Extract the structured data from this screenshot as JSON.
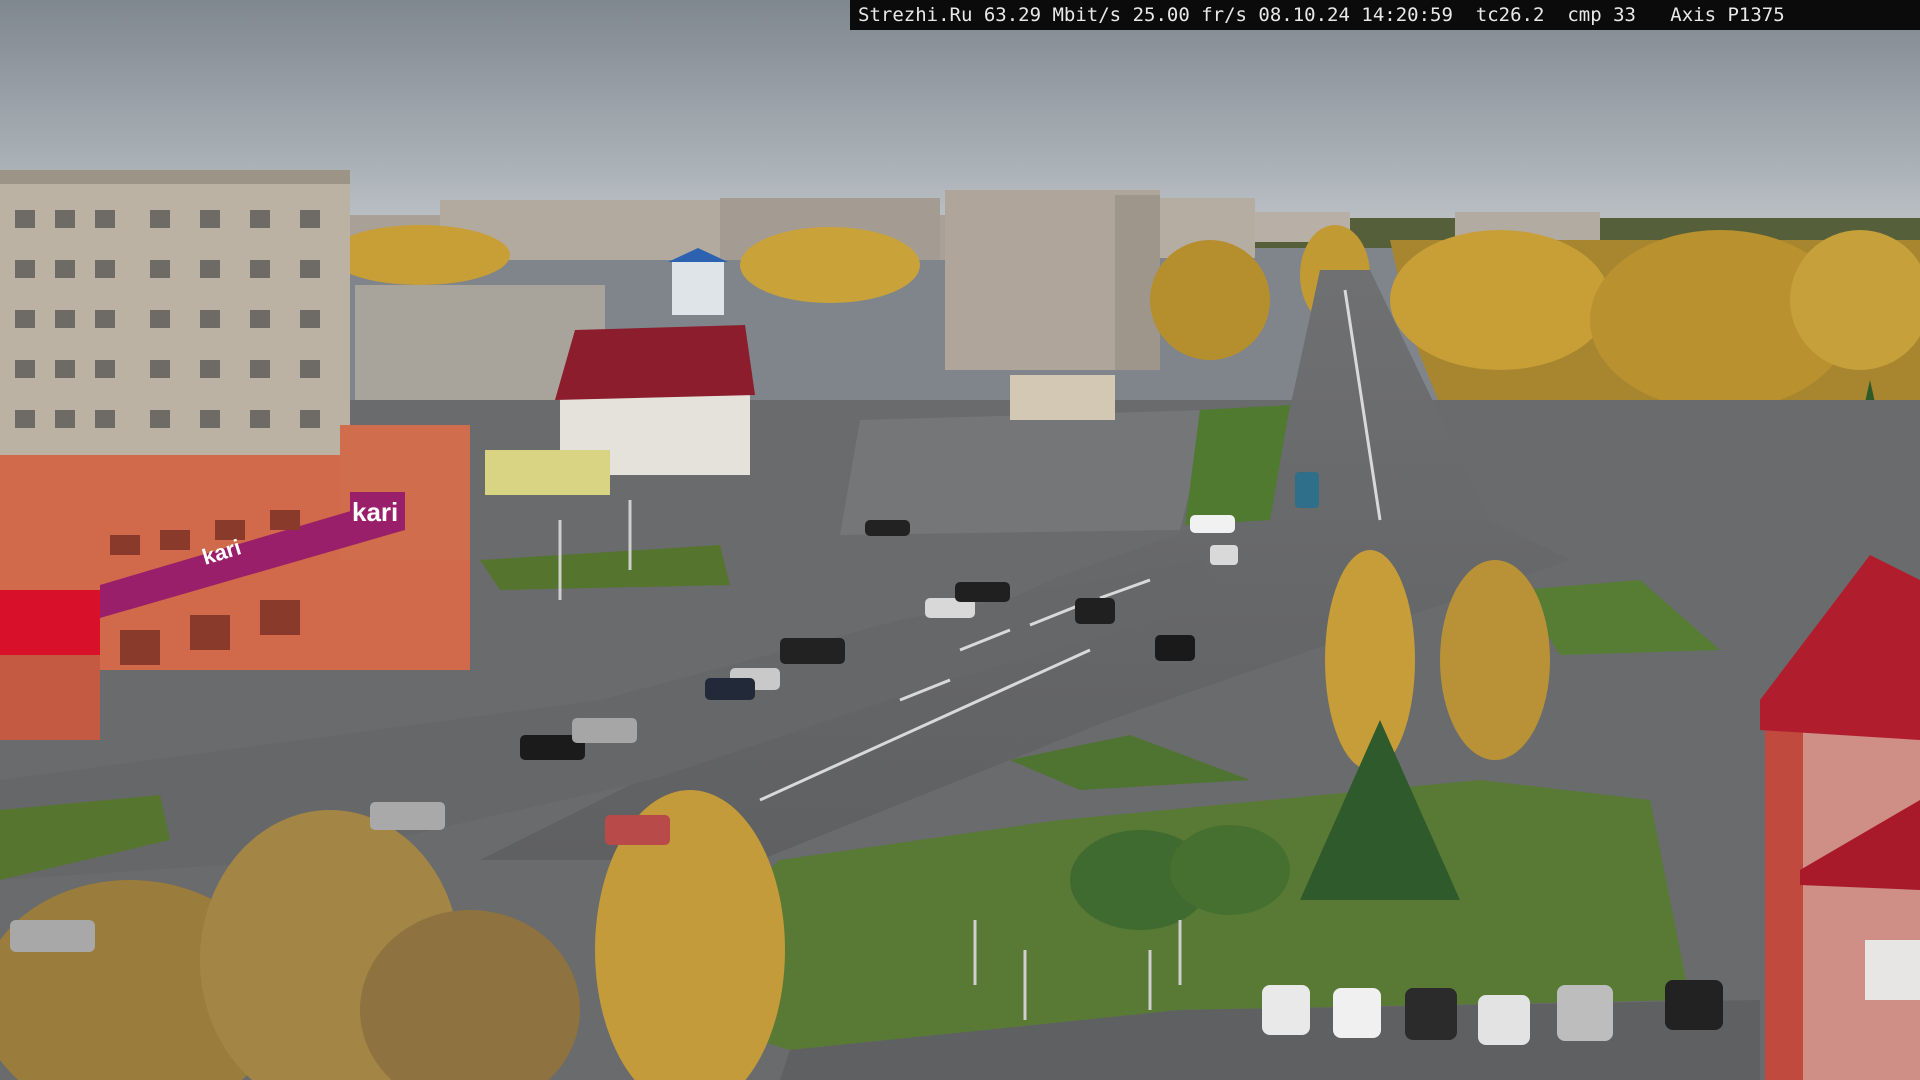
{
  "overlay": {
    "site": "Strezhi.Ru",
    "bitrate": "63.29 Mbit/s",
    "framerate": "25.00 fr/s",
    "date": "08.10.24",
    "time": "14:20:59",
    "tc": "tc26.2",
    "cmp": "cmp 33",
    "camera": "Axis P1375"
  },
  "signs": {
    "store_logo": "kari",
    "store_banner": "kari"
  },
  "colors": {
    "sky": "#a9b0b6",
    "asphalt": "#6d6e6f",
    "grass": "#5c7a35",
    "autumn_foliage": "#c9a23a",
    "store_facade": "#d06a4a",
    "store_banner": "#9a1f6a",
    "roof_red": "#b01e2e"
  }
}
